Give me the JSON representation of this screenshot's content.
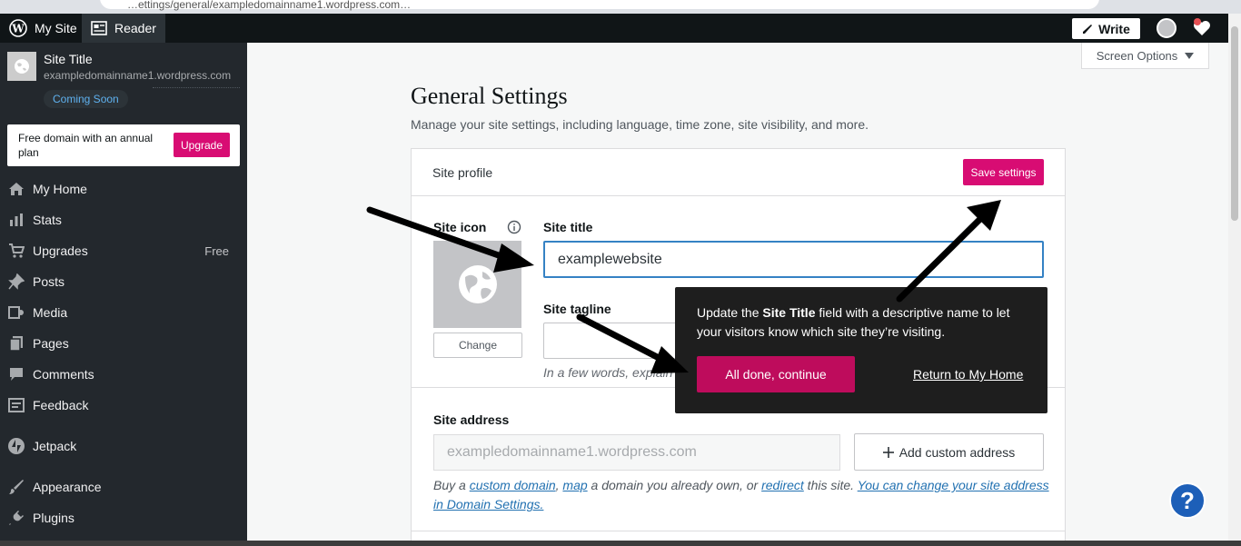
{
  "browser": {
    "url_fragment": "…ettings/general/exampledomainname1.wordpress.com…"
  },
  "adminbar": {
    "my_site": "My Site",
    "reader": "Reader",
    "write": "Write"
  },
  "site": {
    "title": "Site Title",
    "url": "exampledomainname1.wordpress.com",
    "status_badge": "Coming Soon"
  },
  "upgrade_card": {
    "text": "Free domain with an annual plan",
    "button": "Upgrade"
  },
  "menu": [
    {
      "label": "My Home",
      "icon": "home-icon"
    },
    {
      "label": "Stats",
      "icon": "stats-icon"
    },
    {
      "label": "Upgrades",
      "icon": "cart-icon",
      "badge": "Free"
    },
    {
      "label": "Posts",
      "icon": "pin-icon"
    },
    {
      "label": "Media",
      "icon": "media-icon"
    },
    {
      "label": "Pages",
      "icon": "pages-icon"
    },
    {
      "label": "Comments",
      "icon": "comment-icon"
    },
    {
      "label": "Feedback",
      "icon": "feedback-icon"
    },
    {
      "label": "Jetpack",
      "icon": "jetpack-icon"
    },
    {
      "label": "Appearance",
      "icon": "brush-icon"
    },
    {
      "label": "Plugins",
      "icon": "plug-icon"
    }
  ],
  "screen_options": "Screen Options",
  "page": {
    "title": "General Settings",
    "subtitle": "Manage your site settings, including language, time zone, site visibility, and more."
  },
  "profile": {
    "header": "Site profile",
    "save_button": "Save settings",
    "site_icon_label": "Site icon",
    "change_button": "Change",
    "site_title_label": "Site title",
    "site_title_value": "examplewebsite",
    "tagline_label": "Site tagline",
    "tagline_hint": "In a few words, explain what this site is about.",
    "address_label": "Site address",
    "address_value": "exampledomainname1.wordpress.com",
    "add_custom_address": "Add custom address",
    "help": {
      "p1": "Buy a ",
      "link1": "custom domain",
      "p2": ", ",
      "link2": "map",
      "p3": " a domain you already own, or ",
      "link3": "redirect",
      "p4": " this site. ",
      "link4": "You can change your site address in Domain Settings."
    }
  },
  "tour": {
    "text_before": "Update the ",
    "text_bold": "Site Title",
    "text_after": " field with a descriptive name to let your visitors know which site they’re visiting.",
    "continue_button": "All done, continue",
    "return_link": "Return to My Home"
  },
  "help_button": "?",
  "colors": {
    "accent": "#d80c73",
    "sidebar": "#23282d",
    "link": "#2271b1"
  }
}
